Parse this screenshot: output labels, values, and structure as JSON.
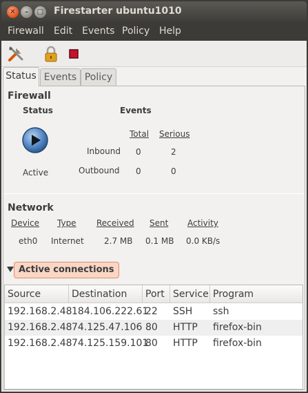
{
  "window": {
    "title": "Firestarter ubuntu1010"
  },
  "menu": [
    "Firewall",
    "Edit",
    "Events",
    "Policy",
    "Help"
  ],
  "toolbar": {
    "icons": [
      "preferences-icon",
      "lock-icon",
      "stop-icon"
    ]
  },
  "tabs": [
    "Status",
    "Events",
    "Policy"
  ],
  "firewall": {
    "title": "Firewall",
    "status_label": "Status",
    "events_label": "Events",
    "state": "Active",
    "col_total": "Total",
    "col_serious": "Serious",
    "inbound_label": "Inbound",
    "outbound_label": "Outbound",
    "inbound_total": "0",
    "inbound_serious": "2",
    "outbound_total": "0",
    "outbound_serious": "0"
  },
  "network": {
    "title": "Network",
    "headers": [
      "Device",
      "Type",
      "Received",
      "Sent",
      "Activity"
    ],
    "row": [
      "eth0",
      "Internet",
      "2.7 MB",
      "0.1 MB",
      "0.0 KB/s"
    ]
  },
  "connections": {
    "expander_label": "Active connections",
    "headers": [
      "Source",
      "Destination",
      "Port",
      "Service",
      "Program"
    ],
    "rows": [
      [
        "192.168.2.48",
        "184.106.222.61",
        "22",
        "SSH",
        "ssh"
      ],
      [
        "192.168.2.48",
        "74.125.47.106",
        "80",
        "HTTP",
        "firefox-bin"
      ],
      [
        "192.168.2.48",
        "74.125.159.101",
        "80",
        "HTTP",
        "firefox-bin"
      ]
    ]
  }
}
